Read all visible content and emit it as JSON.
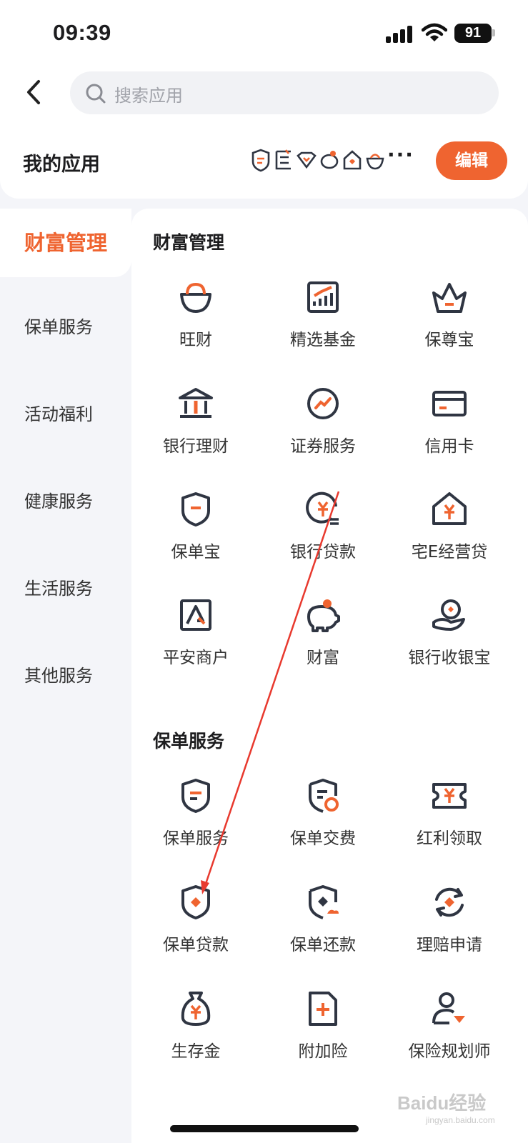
{
  "status_bar": {
    "time": "09:39",
    "battery": "91"
  },
  "search": {
    "placeholder": "搜索应用"
  },
  "my_apps": {
    "title": "我的应用",
    "more": "···",
    "edit_label": "编辑"
  },
  "sidebar": {
    "items": [
      {
        "label": "财富管理",
        "active": true
      },
      {
        "label": "保单服务"
      },
      {
        "label": "活动福利"
      },
      {
        "label": "健康服务"
      },
      {
        "label": "生活服务"
      },
      {
        "label": "其他服务"
      }
    ]
  },
  "sections": [
    {
      "title": "财富管理",
      "apps": [
        {
          "label": "旺财",
          "icon": "gold-ingot-icon"
        },
        {
          "label": "精选基金",
          "icon": "fund-chart-icon"
        },
        {
          "label": "保尊宝",
          "icon": "crown-icon"
        },
        {
          "label": "银行理财",
          "icon": "bank-icon"
        },
        {
          "label": "证券服务",
          "icon": "trend-icon"
        },
        {
          "label": "信用卡",
          "icon": "credit-card-icon"
        },
        {
          "label": "保单宝",
          "icon": "shield-icon"
        },
        {
          "label": "银行贷款",
          "icon": "loan-coin-icon"
        },
        {
          "label": "宅E经营贷",
          "icon": "house-yuan-icon"
        },
        {
          "label": "平安商户",
          "icon": "merchant-icon"
        },
        {
          "label": "财富",
          "icon": "piggy-bank-icon"
        },
        {
          "label": "银行收银宝",
          "icon": "cashier-icon"
        }
      ]
    },
    {
      "title": "保单服务",
      "apps": [
        {
          "label": "保单服务",
          "icon": "policy-shield-icon"
        },
        {
          "label": "保单交费",
          "icon": "policy-pay-icon"
        },
        {
          "label": "红利领取",
          "icon": "dividend-ticket-icon"
        },
        {
          "label": "保单贷款",
          "icon": "policy-loan-icon"
        },
        {
          "label": "保单还款",
          "icon": "policy-repay-icon"
        },
        {
          "label": "理赔申请",
          "icon": "claim-cycle-icon"
        },
        {
          "label": "生存金",
          "icon": "money-bag-icon"
        },
        {
          "label": "附加险",
          "icon": "add-document-icon"
        },
        {
          "label": "保险规划师",
          "icon": "planner-icon"
        }
      ]
    }
  ],
  "watermark": {
    "brand": "Baidu经验",
    "domain": "jingyan.baidu.com"
  },
  "colors": {
    "accent": "#ef6430",
    "icon_dark": "#2f3542",
    "sidebar_bg": "#f4f5f9"
  }
}
